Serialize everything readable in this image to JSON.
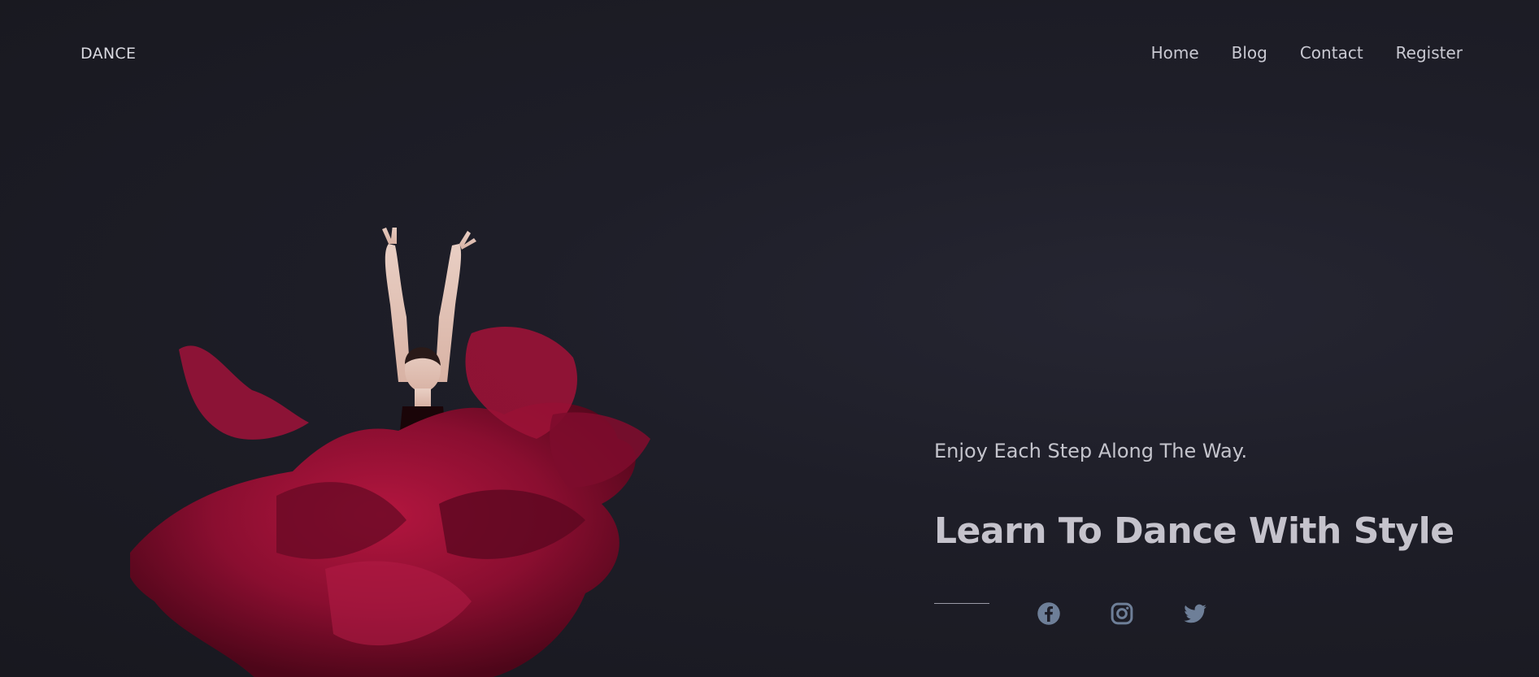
{
  "header": {
    "logo": "DANCE",
    "nav": [
      {
        "label": "Home"
      },
      {
        "label": "Blog"
      },
      {
        "label": "Contact"
      },
      {
        "label": "Register"
      }
    ]
  },
  "hero": {
    "tagline": "Enjoy Each Step Along The Way.",
    "headline": "Learn To Dance With Style",
    "social": [
      {
        "icon": "facebook-icon"
      },
      {
        "icon": "instagram-icon"
      },
      {
        "icon": "twitter-icon"
      }
    ]
  },
  "colors": {
    "background": "#1e1e28",
    "text": "#c5c3cc",
    "dress": "#8c0f33",
    "social_icon": "#6e7f98"
  }
}
